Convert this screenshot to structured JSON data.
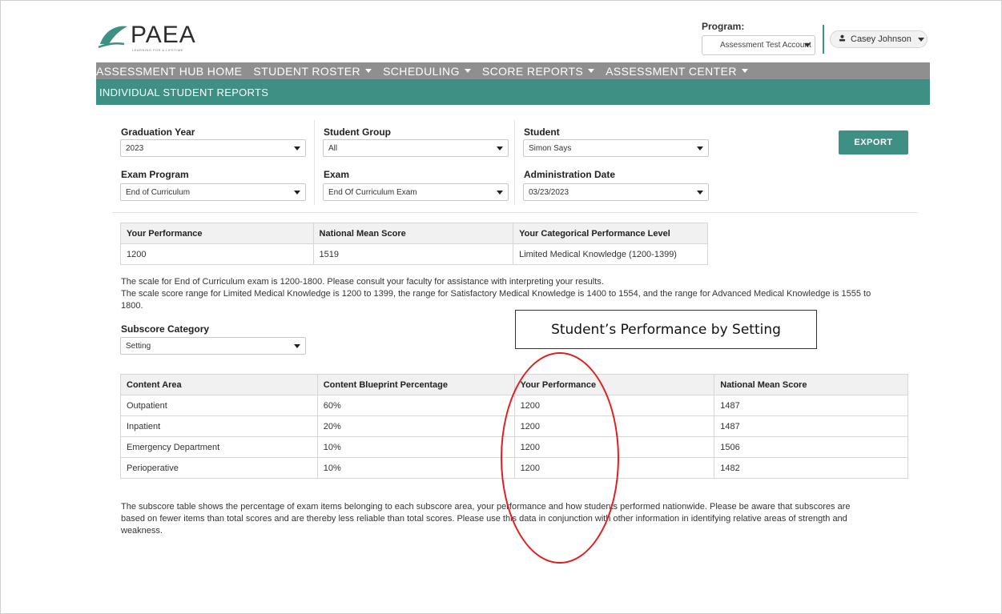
{
  "header": {
    "logo_text": "PAEA",
    "logo_tagline": "LEARNING FOR A LIFETIME",
    "brand_color": "#3e8f84",
    "program_label": "Program:",
    "program_value": "Assessment Test Account",
    "user_name": "Casey Johnson",
    "user_icon": "person-icon"
  },
  "nav": {
    "items": [
      {
        "label": "ASSESSMENT HUB HOME",
        "has_caret": false
      },
      {
        "label": "STUDENT ROSTER",
        "has_caret": true
      },
      {
        "label": "SCHEDULING",
        "has_caret": true
      },
      {
        "label": "SCORE REPORTS",
        "has_caret": true
      },
      {
        "label": "ASSESSMENT CENTER",
        "has_caret": true
      }
    ],
    "bar_color": "#8f8f8f",
    "page_title": "INDIVIDUAL STUDENT REPORTS"
  },
  "filters": {
    "graduation_year": {
      "label": "Graduation Year",
      "value": "2023"
    },
    "student_group": {
      "label": "Student Group",
      "value": "All"
    },
    "student": {
      "label": "Student",
      "value": "Simon Says"
    },
    "exam_program": {
      "label": "Exam Program",
      "value": "End of Curriculum"
    },
    "exam": {
      "label": "Exam",
      "value": "End Of Curriculum Exam"
    },
    "administration_date": {
      "label": "Administration Date",
      "value": "03/23/2023"
    },
    "export_label": "EXPORT"
  },
  "summary_table": {
    "headers": [
      "Your Performance",
      "National Mean Score",
      "Your Categorical Performance Level"
    ],
    "row": [
      "1200",
      "1519",
      "Limited Medical Knowledge (1200-1399)"
    ]
  },
  "scale_text": {
    "line1": "The scale for End of Curriculum exam is 1200-1800. Please consult your faculty for assistance with interpreting your results.",
    "line2": "The scale score range for Limited Medical Knowledge is 1200 to 1399, the range for Satisfactory Medical Knowledge is 1400 to 1554, and the range for Advanced Medical Knowledge is 1555 to",
    "line3": "1800."
  },
  "subscore": {
    "label": "Subscore Category",
    "value": "Setting"
  },
  "callout": {
    "text": "Student’s Performance by Setting",
    "highlight_color": "#e0201f"
  },
  "subscore_table": {
    "headers": [
      "Content Area",
      "Content Blueprint Percentage",
      "Your Performance",
      "National Mean Score"
    ],
    "rows": [
      [
        "Outpatient",
        "60%",
        "1200",
        "1487"
      ],
      [
        "Inpatient",
        "20%",
        "1200",
        "1487"
      ],
      [
        "Emergency Department",
        "10%",
        "1200",
        "1506"
      ],
      [
        "Perioperative",
        "10%",
        "1200",
        "1482"
      ]
    ]
  },
  "footnote": {
    "line1": "The subscore table shows the percentage of exam items belonging to each subscore area, your performance and how students performed nationwide. Please be aware that subscores are",
    "line2": "based on fewer items than total scores and are thereby less reliable than total scores. Please use this data in conjunction with other information in identifying relative areas of strength and",
    "line3": "weakness."
  }
}
